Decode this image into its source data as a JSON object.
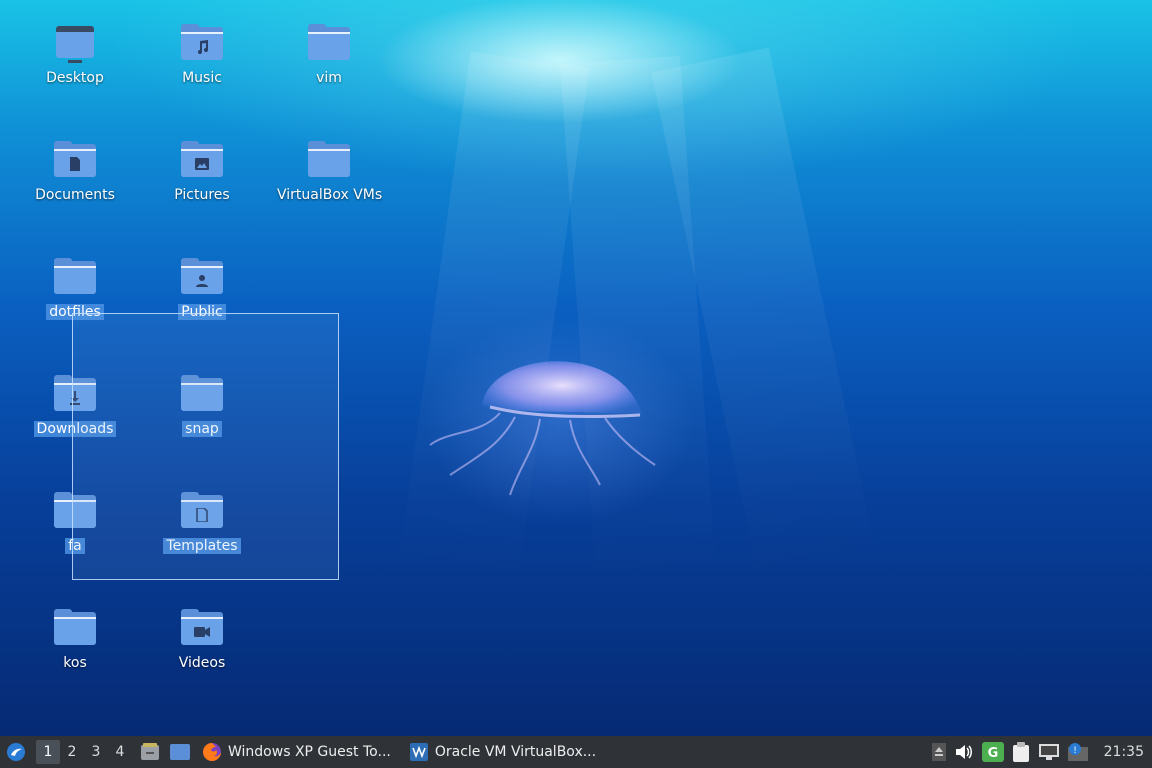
{
  "desktop": {
    "icons": [
      {
        "label": "Desktop",
        "glyph": "desktop-icon",
        "selected": false
      },
      {
        "label": "Music",
        "glyph": "music-note-icon",
        "selected": false
      },
      {
        "label": "vim",
        "glyph": "folder-icon",
        "selected": false
      },
      {
        "label": "Documents",
        "glyph": "document-icon",
        "selected": false
      },
      {
        "label": "Pictures",
        "glyph": "image-icon",
        "selected": false
      },
      {
        "label": "VirtualBox VMs",
        "glyph": "folder-icon",
        "selected": false
      },
      {
        "label": "dotfiles",
        "glyph": "folder-icon",
        "selected": true
      },
      {
        "label": "Public",
        "glyph": "person-icon",
        "selected": true
      },
      {
        "label": "Downloads",
        "glyph": "download-icon",
        "selected": true
      },
      {
        "label": "snap",
        "glyph": "folder-icon",
        "selected": true
      },
      {
        "label": "fa",
        "glyph": "folder-icon",
        "selected": true
      },
      {
        "label": "Templates",
        "glyph": "template-icon",
        "selected": true
      },
      {
        "label": "kos",
        "glyph": "folder-icon",
        "selected": false
      },
      {
        "label": "Videos",
        "glyph": "video-camera-icon",
        "selected": false
      }
    ]
  },
  "taskbar": {
    "menu_icon": "lubuntu-logo-icon",
    "workspaces": [
      "1",
      "2",
      "3",
      "4"
    ],
    "active_workspace": "1",
    "launchers": [
      "file-manager-icon",
      "show-desktop-icon"
    ],
    "tasks": [
      {
        "title": "Windows XP Guest To...",
        "icon": "firefox-icon"
      },
      {
        "title": "Oracle VM VirtualBox...",
        "icon": "virtualbox-icon"
      }
    ],
    "tray": [
      "eject-icon",
      "volume-icon",
      "gnome-updater-icon",
      "clipboard-icon",
      "network-icon",
      "notification-icon"
    ],
    "clock": "21:35"
  },
  "colors": {
    "taskbar_bg": "#2f3338",
    "selection": "#4a90e2",
    "folder": "#6aa2ea"
  }
}
